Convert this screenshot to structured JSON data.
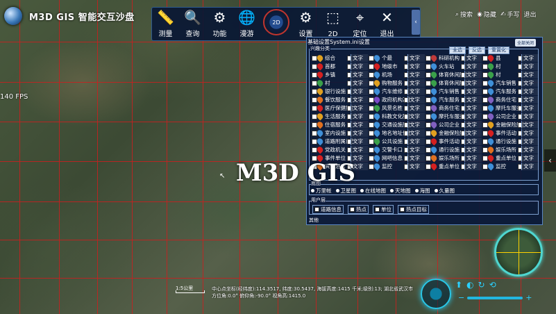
{
  "app": {
    "title": "M3D GIS 智能交互沙盘",
    "fps": "140 FPS",
    "center_text": "M3D GIS"
  },
  "toolbar": {
    "items": [
      {
        "label": "测量",
        "icon": "ruler-icon",
        "glyph": "📏"
      },
      {
        "label": "查询",
        "icon": "search-icon",
        "glyph": "🔍"
      },
      {
        "label": "功能",
        "icon": "gear-icon",
        "glyph": "⚙"
      },
      {
        "label": "漫游",
        "icon": "globe-pin-icon",
        "glyph": "🌐"
      },
      {
        "label": "2D",
        "icon": "2d-ring-icon",
        "glyph": "2D"
      },
      {
        "label": "设置",
        "icon": "settings-icon",
        "glyph": "⚙"
      },
      {
        "label": "2D",
        "icon": "cube-icon",
        "glyph": "⬚"
      },
      {
        "label": "定位",
        "icon": "location-icon",
        "glyph": "⌖"
      },
      {
        "label": "退出",
        "icon": "close-icon",
        "glyph": "✕"
      }
    ],
    "collapse_glyph": "‹"
  },
  "topright": {
    "search": "搜索",
    "hide": "隐藏",
    "hand": "手写",
    "exit": "退出"
  },
  "panel": {
    "title": "基础设置System.ini设置",
    "close_all": "全部关闭",
    "select_all": "全选",
    "invert": "反选",
    "reset": "重置化",
    "poi_legend": "兴趣分类",
    "text_label": "文字",
    "poi_items": [
      {
        "name": "综合",
        "color": "#e0a020"
      },
      {
        "name": "个最",
        "color": "#3f8fd8"
      },
      {
        "name": "科研机构",
        "color": "#c03a3a"
      },
      {
        "name": "县",
        "color": "#d42020"
      },
      {
        "name": "首都",
        "color": "#d42020"
      },
      {
        "name": "地级市",
        "color": "#d42020"
      },
      {
        "name": "火车站",
        "color": "#3f8fd8"
      },
      {
        "name": "村",
        "color": "#3aa04a"
      },
      {
        "name": "乡镇",
        "color": "#d42020"
      },
      {
        "name": "机场",
        "color": "#3f8fd8"
      },
      {
        "name": "体育休闲服务",
        "color": "#3aa04a"
      },
      {
        "name": "村",
        "color": "#3aa04a"
      },
      {
        "name": "村",
        "color": "#3aa04a"
      },
      {
        "name": "购物服务",
        "color": "#e0a020"
      },
      {
        "name": "体育休闲服务",
        "color": "#3aa04a"
      },
      {
        "name": "汽车销售",
        "color": "#3f8fd8"
      },
      {
        "name": "银行设施",
        "color": "#e0a020"
      },
      {
        "name": "汽车维修",
        "color": "#3f8fd8"
      },
      {
        "name": "汽车销售",
        "color": "#3f8fd8"
      },
      {
        "name": "汽车服务",
        "color": "#3f8fd8"
      },
      {
        "name": "餐饮服务",
        "color": "#e07020"
      },
      {
        "name": "政府机构及社会团体",
        "color": "#7a4ac8"
      },
      {
        "name": "汽车服务",
        "color": "#3f8fd8"
      },
      {
        "name": "商务住宅",
        "color": "#8060c0"
      },
      {
        "name": "医疗保健服务",
        "color": "#d42020"
      },
      {
        "name": "风景名胜",
        "color": "#3aa04a"
      },
      {
        "name": "商务住宅",
        "color": "#8060c0"
      },
      {
        "name": "摩托车服务",
        "color": "#3f8fd8"
      },
      {
        "name": "生活服务",
        "color": "#e0a020"
      },
      {
        "name": "科教文化服务",
        "color": "#3f8fd8"
      },
      {
        "name": "摩托车服务",
        "color": "#3f8fd8"
      },
      {
        "name": "公司企业",
        "color": "#8060c0"
      },
      {
        "name": "住宿服务",
        "color": "#e07020"
      },
      {
        "name": "交通设施服务",
        "color": "#3f8fd8"
      },
      {
        "name": "公司企业",
        "color": "#8060c0"
      },
      {
        "name": "金融保险服务",
        "color": "#e0a020"
      },
      {
        "name": "室内设施",
        "color": "#3f8fd8"
      },
      {
        "name": "地名地址信息",
        "color": "#3f8fd8"
      },
      {
        "name": "金融保险服务",
        "color": "#e0a020"
      },
      {
        "name": "事件活动",
        "color": "#d42020"
      },
      {
        "name": "道路附属设施",
        "color": "#3f8fd8"
      },
      {
        "name": "公共设施",
        "color": "#3aa04a"
      },
      {
        "name": "事件活动",
        "color": "#d42020"
      },
      {
        "name": "通行设施",
        "color": "#3f8fd8"
      },
      {
        "name": "党政机关",
        "color": "#d42020"
      },
      {
        "name": "交警卡口",
        "color": "#3f8fd8"
      },
      {
        "name": "通行设施",
        "color": "#3f8fd8"
      },
      {
        "name": "娱乐场所",
        "color": "#e07020"
      },
      {
        "name": "事件单位",
        "color": "#d42020"
      },
      {
        "name": "网吧信息",
        "color": "#3f8fd8"
      },
      {
        "name": "娱乐场所",
        "color": "#e07020"
      },
      {
        "name": "重点单位",
        "color": "#d42020"
      },
      {
        "name": "宾馆酒店",
        "color": "#e07020"
      },
      {
        "name": "监控",
        "color": "#3f8fd8"
      },
      {
        "name": "重点单位",
        "color": "#d42020"
      },
      {
        "name": "监控",
        "color": "#3f8fd8"
      }
    ],
    "map_legend": "底图",
    "map_options": [
      "万里帐",
      "卫星图",
      "在线地图",
      "天地图",
      "海图",
      "久量图"
    ],
    "user_legend": "用户层",
    "user_options": [
      "道路信息",
      "热点",
      "单位",
      "热点目标"
    ],
    "more_legend": "其他"
  },
  "status": {
    "scale": "1:5公里",
    "line1": "中心点坐标(经纬度):114.3517, 纬度:30.5437, 海拔高度:1415 千米;级别:13; 湖北省武汉市",
    "line2": "方位角:0.0° 俯仰角:-90.0° 视角高:1415.0"
  },
  "widgets": {
    "side_arrow": "‹",
    "cursor": "↖"
  }
}
